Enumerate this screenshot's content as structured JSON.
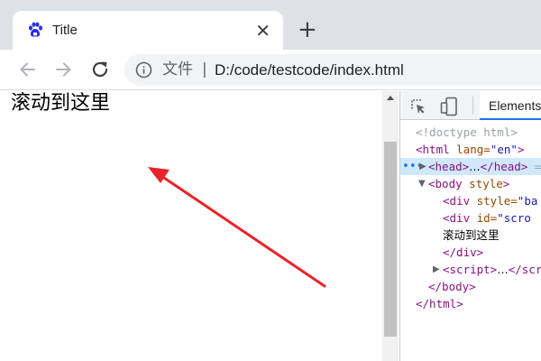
{
  "browser": {
    "tab": {
      "title": "Title",
      "favicon": "baidu-paw-icon",
      "close_glyph": "✕"
    },
    "new_tab_glyph": "+",
    "address": {
      "scheme_label": "文件",
      "separator": "|",
      "url": "D:/code/testcode/index.html"
    },
    "colors": {
      "accent": "#1a73e8",
      "favicon": "#2932e1",
      "arrow": "#e8232a"
    }
  },
  "page": {
    "text": "滚动到这里",
    "scroll_fraction": 0.28
  },
  "devtools": {
    "active_tab": "Elements",
    "dom": {
      "doctype": "<!doctype html>",
      "html_open": {
        "tag": "<html",
        "attr": " lang=",
        "value": "\"en\"",
        "close": ">"
      },
      "head": {
        "dots": "•••",
        "open": "<head>",
        "ellipsis": "…",
        "close": "</head>",
        "tail": " ="
      },
      "body_open": {
        "tag": "<body",
        "attr": " style",
        "close": ">"
      },
      "div1": {
        "tag": "<div",
        "attr": " style=",
        "value": "\"ba"
      },
      "div2": {
        "tag": "<div",
        "attr": " id=",
        "value": "\"scro"
      },
      "div2_text": "滚动到这里",
      "div_close": "</div>",
      "script": {
        "open": "<script>",
        "ellipsis": "…",
        "close": "</scr"
      },
      "body_close": "</body>",
      "html_close": "</html>"
    }
  }
}
